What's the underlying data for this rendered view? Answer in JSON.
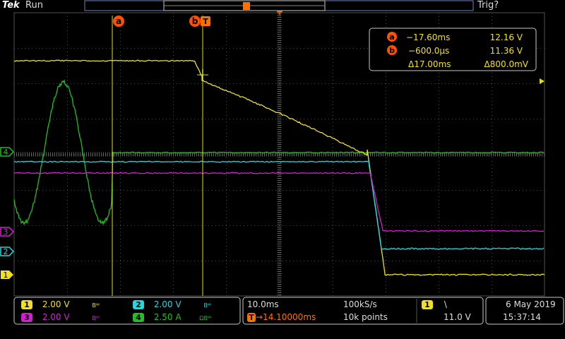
{
  "header": {
    "brand": "Tek",
    "run_status": "Run",
    "trigger_status": "Trig?",
    "trigger_marker_icon": "T"
  },
  "cursors": {
    "a_label": "a",
    "b_label": "b",
    "trigger_label": "T"
  },
  "readout": {
    "a": {
      "time": "−17.60ms",
      "value": "12.16 V"
    },
    "b": {
      "time": "−600.0µs",
      "value": "11.36 V"
    },
    "delta": {
      "time": "Δ17.00ms",
      "value": "Δ800.0mV"
    }
  },
  "channel_markers": [
    "4",
    "3",
    "2",
    "1"
  ],
  "channels": [
    {
      "id": "1",
      "scale": "2.00 V",
      "bw": "Bᵂ",
      "color": "#f0e020"
    },
    {
      "id": "2",
      "scale": "2.00 V",
      "bw": "Bᵂ",
      "color": "#20d8e0"
    },
    {
      "id": "3",
      "scale": "2.00 V",
      "bw": "Bᵂ",
      "color": "#d020d0"
    },
    {
      "id": "4",
      "scale": "2.50 A",
      "bw": "ΩBᵂ",
      "color": "#20c020"
    }
  ],
  "timebase": {
    "scale": "10.0ms",
    "sample_rate": "100kS/s",
    "position": "→14.10000ms",
    "record_length": "10k points"
  },
  "trigger": {
    "channel": "1",
    "slope_icon": "\\",
    "level": "11.0 V"
  },
  "clock": {
    "date": "6 May 2019",
    "time": "15:37:14"
  },
  "colors": {
    "ch1": "#f0e020",
    "ch2": "#20d8e0",
    "ch3": "#d020d0",
    "ch4": "#20c020",
    "cursor": "#e0e020",
    "accent": "#ff7000",
    "panel_border": "#c8c8c8"
  }
}
